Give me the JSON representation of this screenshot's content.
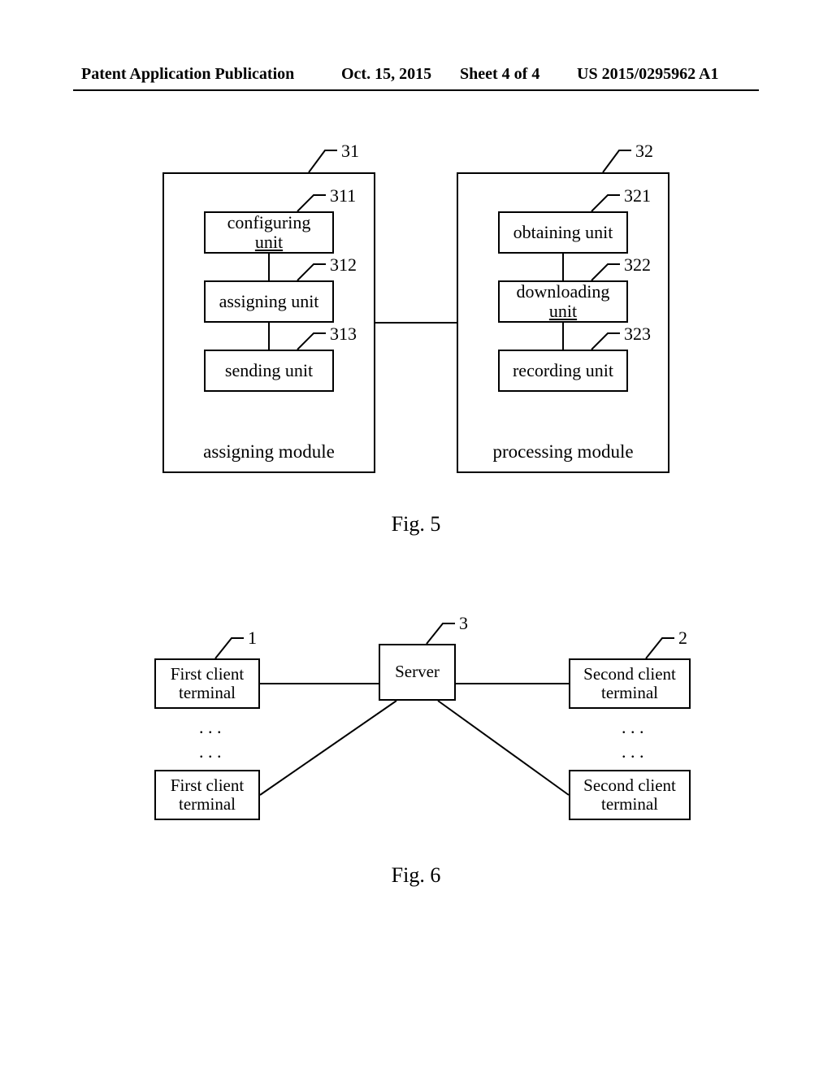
{
  "header": {
    "publication_label": "Patent Application Publication",
    "date": "Oct. 15, 2015",
    "sheet": "Sheet 4 of 4",
    "pub_number": "US 2015/0295962 A1"
  },
  "fig5": {
    "caption": "Fig. 5",
    "module_left": {
      "ref": "31",
      "label": "assigning module",
      "units": [
        {
          "ref": "311",
          "label_top": "configuring",
          "label_bottom": "unit"
        },
        {
          "ref": "312",
          "label_top": "assigning unit",
          "label_bottom": ""
        },
        {
          "ref": "313",
          "label_top": "sending unit",
          "label_bottom": ""
        }
      ]
    },
    "module_right": {
      "ref": "32",
      "label": "processing module",
      "units": [
        {
          "ref": "321",
          "label_top": "obtaining unit",
          "label_bottom": ""
        },
        {
          "ref": "322",
          "label_top": "downloading",
          "label_bottom": "unit"
        },
        {
          "ref": "323",
          "label_top": "recording unit",
          "label_bottom": ""
        }
      ]
    }
  },
  "fig6": {
    "caption": "Fig. 6",
    "server": {
      "ref": "3",
      "label": "Server"
    },
    "first_client": {
      "ref": "1",
      "label": "First client terminal"
    },
    "second_client": {
      "ref": "2",
      "label": "Second client terminal"
    },
    "ellipsis": ". . ."
  }
}
